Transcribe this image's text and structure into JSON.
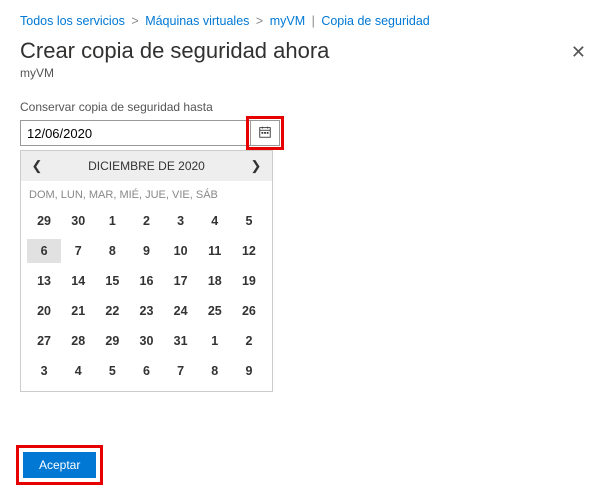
{
  "breadcrumb": {
    "items": [
      {
        "label": "Todos los servicios"
      },
      {
        "label": "Máquinas virtuales"
      },
      {
        "label": "myVM"
      },
      {
        "label": "Copia de seguridad"
      }
    ],
    "sep": ">"
  },
  "header": {
    "title": "Crear copia de seguridad ahora",
    "subtitle": "myVM"
  },
  "field": {
    "label": "Conservar copia de seguridad hasta",
    "value": "12/06/2020"
  },
  "calendar": {
    "title": "DICIEMBRE DE 2020",
    "dow": "DOM, LUN, MAR, MIÉ, JUE, VIE, SÁB",
    "prev_glyph": "❮",
    "next_glyph": "❯",
    "selected": 6,
    "selected_row": 1,
    "rows": [
      [
        29,
        30,
        1,
        2,
        3,
        4,
        5
      ],
      [
        6,
        7,
        8,
        9,
        10,
        11,
        12
      ],
      [
        13,
        14,
        15,
        16,
        17,
        18,
        19
      ],
      [
        20,
        21,
        22,
        23,
        24,
        25,
        26
      ],
      [
        27,
        28,
        29,
        30,
        31,
        1,
        2
      ],
      [
        3,
        4,
        5,
        6,
        7,
        8,
        9
      ]
    ]
  },
  "footer": {
    "accept": "Aceptar"
  },
  "icons": {
    "calendar": "calendar-icon",
    "close": "✕"
  },
  "colors": {
    "accent": "#0078d4",
    "highlight": "#e60000"
  }
}
